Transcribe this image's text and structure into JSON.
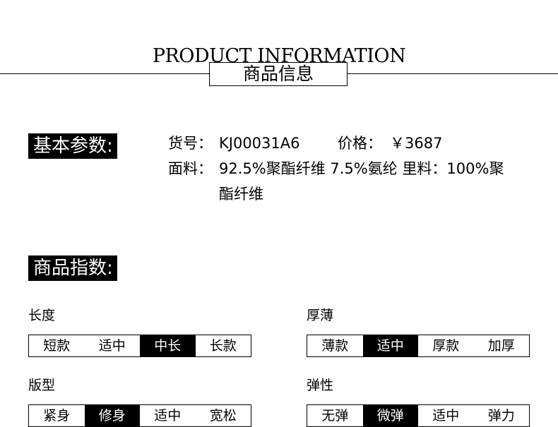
{
  "header": {
    "title_en": "PRODUCT INFORMATION",
    "title_cn": "商品信息"
  },
  "basic": {
    "label": "基本参数:",
    "item_no_label": "货号：",
    "item_no": "KJ00031A6",
    "price_label": "价格：",
    "price": "￥3687",
    "fabric_label": "面料：",
    "fabric_line1": "92.5%聚酯纤维 7.5%氨纶 里料：100%聚",
    "fabric_line2": "酯纤维"
  },
  "index": {
    "label": "商品指数:",
    "categories": [
      {
        "title": "长度",
        "options": [
          "短款",
          "适中",
          "中长",
          "长款"
        ],
        "selected": 2
      },
      {
        "title": "厚薄",
        "options": [
          "薄款",
          "适中",
          "厚款",
          "加厚"
        ],
        "selected": 1
      },
      {
        "title": "版型",
        "options": [
          "紧身",
          "修身",
          "适中",
          "宽松"
        ],
        "selected": 1
      },
      {
        "title": "弹性",
        "options": [
          "无弹",
          "微弹",
          "适中",
          "弹力"
        ],
        "selected": 1
      }
    ]
  }
}
